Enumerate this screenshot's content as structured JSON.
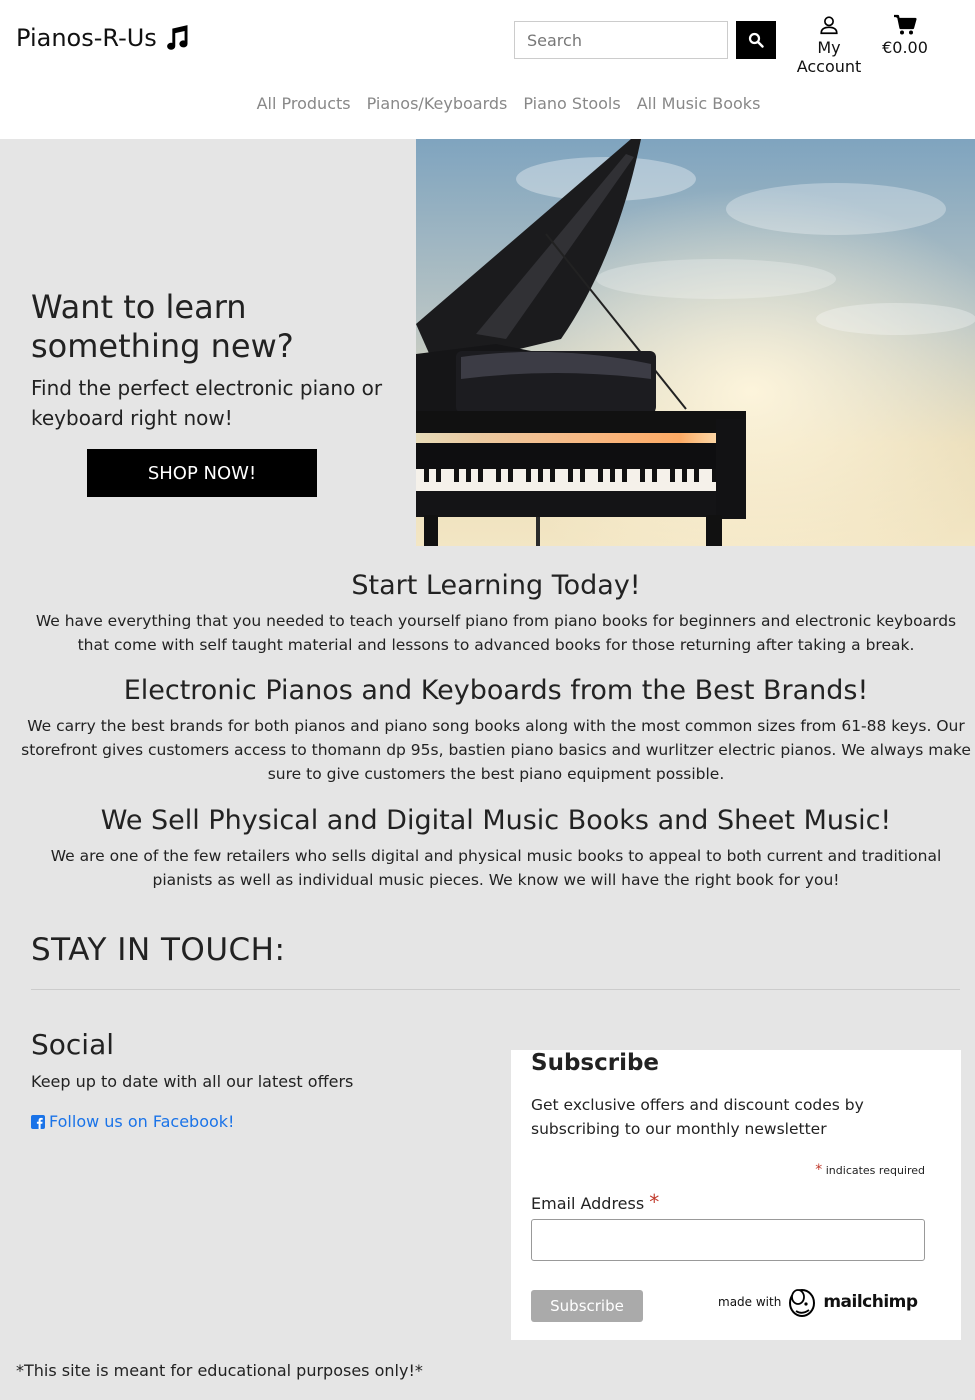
{
  "header": {
    "brand": "Pianos-R-Us",
    "search_placeholder": "Search",
    "account_label": "My Account",
    "cart_total": "€0.00"
  },
  "nav": {
    "items": [
      {
        "label": "All Products"
      },
      {
        "label": "Pianos/Keyboards"
      },
      {
        "label": "Piano Stools"
      },
      {
        "label": "All Music Books"
      }
    ]
  },
  "hero": {
    "title": "Want to learn something new?",
    "subtitle": "Find the perfect electronic piano or keyboard right now!",
    "cta_label": "SHOP NOW!"
  },
  "sections": [
    {
      "title": "Start Learning Today!",
      "body": "We have everything that you needed to teach yourself piano from piano books for beginners and electronic keyboards that come with self taught material and lessons to advanced books for those returning after taking a break."
    },
    {
      "title": "Electronic Pianos and Keyboards from the Best Brands!",
      "body": "We carry the best brands for both pianos and piano song books along with the most common sizes from 61-88 keys. Our storefront gives customers access to thomann dp 95s, bastien piano basics and wurlitzer electric pianos. We always make sure to give customers the best piano equipment possible."
    },
    {
      "title": "We Sell Physical and Digital Music Books and Sheet Music!",
      "body": "We are one of the few retailers who sells digital and physical music books to appeal to both current and traditional pianists as well as individual music pieces. We know we will have the right book for you!"
    }
  ],
  "stay_in_touch": {
    "heading": "STAY IN TOUCH:",
    "social_title": "Social",
    "social_text": "Keep up to date with all our latest offers",
    "facebook_link": "Follow us on Facebook!"
  },
  "subscribe": {
    "title": "Subscribe",
    "text": "Get exclusive offers and discount codes by subscribing to our monthly newsletter",
    "required_star": "*",
    "required_note": " indicates required",
    "email_label": "Email Address ",
    "email_star": "*",
    "button_label": "Subscribe",
    "made_with": "made with",
    "mailchimp": "mailchimp"
  },
  "footer": {
    "note": "*This site is meant for educational purposes only!*"
  },
  "colors": {
    "page_bg": "#e5e5e5",
    "black": "#000000",
    "link": "#1a73e8",
    "nav_text": "#888888",
    "required": "#c0392b"
  },
  "icons": [
    "music-note-icon",
    "search-icon",
    "user-icon",
    "cart-icon",
    "facebook-icon",
    "mailchimp-icon"
  ]
}
